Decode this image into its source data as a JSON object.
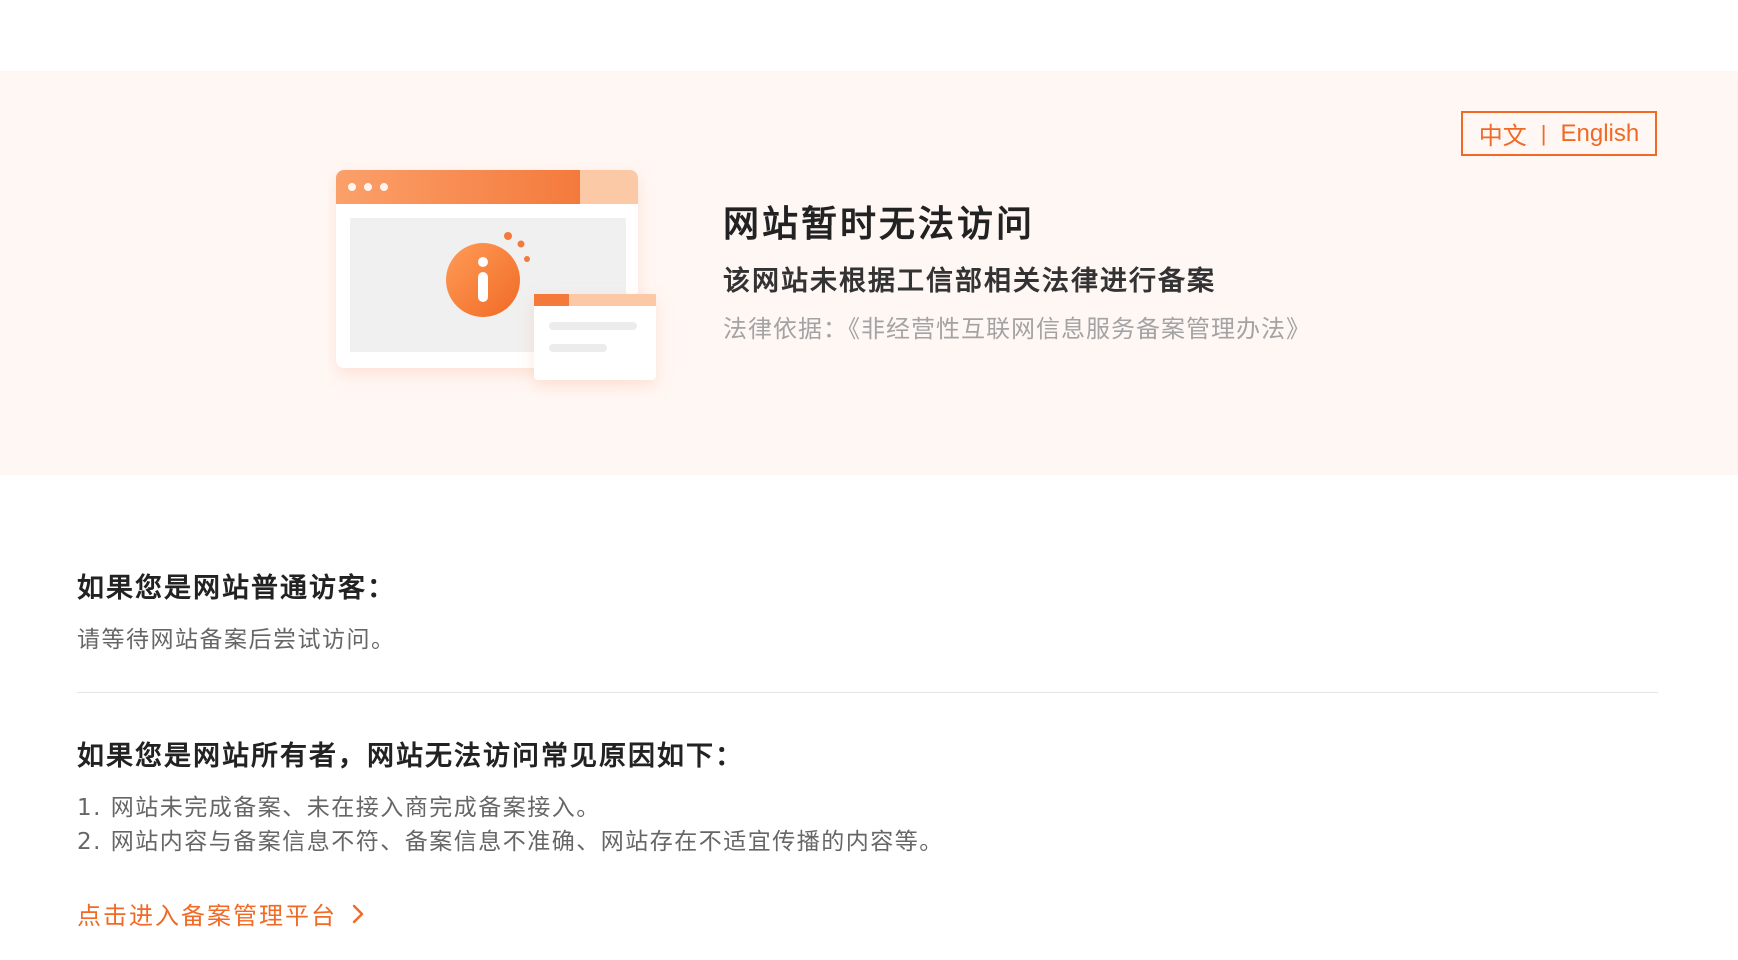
{
  "lang": {
    "zh": "中文",
    "separator": "|",
    "en": "English"
  },
  "notice": {
    "title": "网站暂时无法访问",
    "subtitle": "该网站未根据工信部相关法律进行备案",
    "legal_basis": "法律依据：《非经营性互联网信息服务备案管理办法》"
  },
  "visitor": {
    "heading": "如果您是网站普通访客：",
    "text": "请等待网站备案后尝试访问。"
  },
  "owner": {
    "heading": "如果您是网站所有者，网站无法访问常见原因如下：",
    "reasons": [
      "1. 网站未完成备案、未在接入商完成备案接入。",
      "2. 网站内容与备案信息不符、备案信息不准确、网站存在不适宜传播的内容等。"
    ]
  },
  "link": {
    "label": "点击进入备案管理平台"
  },
  "colors": {
    "accent": "#f06a25",
    "banner_bg": "#fff7f4",
    "divider": "#e5e5e5"
  },
  "icons": {
    "illustration": "browser-window-info-illustration",
    "info": "info-icon",
    "chevron": "chevron-right-icon"
  }
}
